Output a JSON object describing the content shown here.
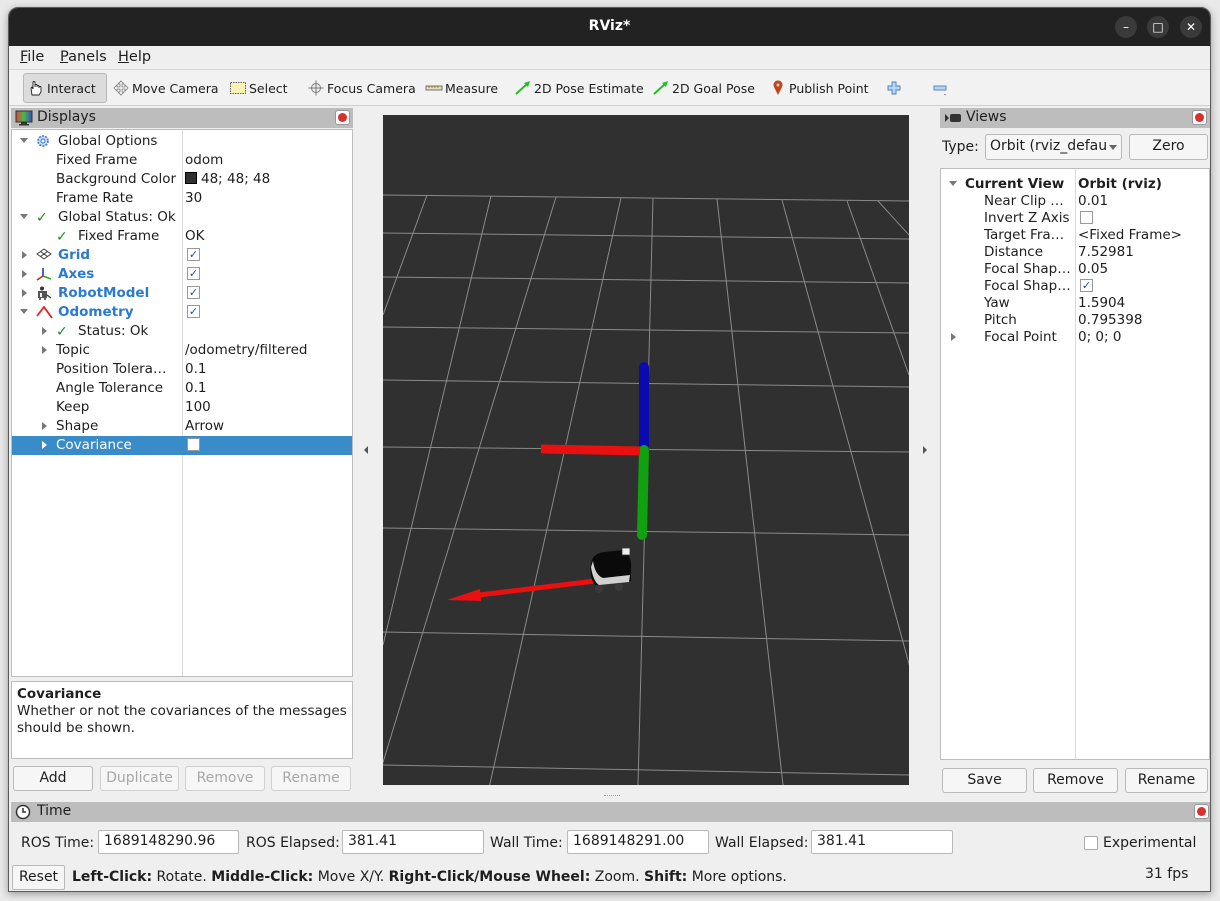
{
  "window": {
    "title": "RViz*",
    "controls": [
      "minimize",
      "maximize",
      "close"
    ]
  },
  "menu": {
    "items": [
      {
        "label": "File",
        "mnemonic": "F",
        "rest": "ile"
      },
      {
        "label": "Panels",
        "mnemonic": "P",
        "rest": "anels"
      },
      {
        "label": "Help",
        "mnemonic": "H",
        "rest": "elp"
      }
    ]
  },
  "toolbar": {
    "tools": [
      {
        "label": "Interact",
        "icon": "hand-pointer-icon",
        "active": true
      },
      {
        "label": "Move Camera",
        "icon": "move-camera-icon"
      },
      {
        "label": "Select",
        "icon": "select-box-icon"
      },
      {
        "label": "Focus Camera",
        "icon": "focus-crosshair-icon"
      },
      {
        "label": "Measure",
        "icon": "ruler-icon"
      },
      {
        "label": "2D Pose Estimate",
        "icon": "green-arrow-icon"
      },
      {
        "label": "2D Goal Pose",
        "icon": "green-arrow-icon"
      },
      {
        "label": "Publish Point",
        "icon": "map-pin-icon"
      }
    ],
    "add_tool_icon": "plus-icon",
    "remove_tool_icon": "minus-icon"
  },
  "displays": {
    "title": "Displays",
    "rows": [
      {
        "name": "Global Options",
        "value": "",
        "indent": 0,
        "expander": "down",
        "icon": "gear-icon"
      },
      {
        "name": "Fixed Frame",
        "value": "odom",
        "indent": 1
      },
      {
        "name": "Background Color",
        "value": "48; 48; 48",
        "indent": 1,
        "swatch": "#303030"
      },
      {
        "name": "Frame Rate",
        "value": "30",
        "indent": 1
      },
      {
        "name": "Global Status: Ok",
        "value": "",
        "indent": 0,
        "expander": "down",
        "icon": "check-icon"
      },
      {
        "name": "Fixed Frame",
        "value": "OK",
        "indent": 1,
        "icon": "check-icon"
      },
      {
        "name": "Grid",
        "value": "",
        "indent": 0,
        "expander": "right",
        "icon": "grid-icon",
        "display": true,
        "checked": true
      },
      {
        "name": "Axes",
        "value": "",
        "indent": 0,
        "expander": "right",
        "icon": "axes-icon",
        "display": true,
        "checked": true
      },
      {
        "name": "RobotModel",
        "value": "",
        "indent": 0,
        "expander": "right",
        "icon": "robot-icon",
        "display": true,
        "checked": true
      },
      {
        "name": "Odometry",
        "value": "",
        "indent": 0,
        "expander": "down",
        "icon": "odometry-icon",
        "display": true,
        "checked": true
      },
      {
        "name": "Status: Ok",
        "value": "",
        "indent": 1,
        "expander": "right",
        "icon": "check-icon"
      },
      {
        "name": "Topic",
        "value": "/odometry/filtered",
        "indent": 1,
        "expander": "right"
      },
      {
        "name": "Position Tolera…",
        "value": "0.1",
        "indent": 1
      },
      {
        "name": "Angle Tolerance",
        "value": "0.1",
        "indent": 1
      },
      {
        "name": "Keep",
        "value": "100",
        "indent": 1
      },
      {
        "name": "Shape",
        "value": "Arrow",
        "indent": 1,
        "expander": "right"
      },
      {
        "name": "Covariance",
        "value": "",
        "indent": 1,
        "expander": "right",
        "selected": true,
        "checkbox": true,
        "checked": false
      }
    ],
    "description_title": "Covariance",
    "description_text": "Whether or not the covariances of the messages should be shown.",
    "buttons": {
      "add": "Add",
      "duplicate": "Duplicate",
      "remove": "Remove",
      "rename": "Rename"
    }
  },
  "views": {
    "title": "Views",
    "type_label": "Type:",
    "type_value": "Orbit (rviz_defau",
    "zero_label": "Zero",
    "rows": [
      {
        "name": "Current View",
        "value": "Orbit (rviz)",
        "bold": true,
        "expander": "down"
      },
      {
        "name": "Near Clip …",
        "value": "0.01"
      },
      {
        "name": "Invert Z Axis",
        "value": "",
        "checkbox": true,
        "checked": false
      },
      {
        "name": "Target Fra…",
        "value": "<Fixed Frame>"
      },
      {
        "name": "Distance",
        "value": "7.52981"
      },
      {
        "name": "Focal Shap…",
        "value": "0.05"
      },
      {
        "name": "Focal Shap…",
        "value": "",
        "checkbox": true,
        "checked": true
      },
      {
        "name": "Yaw",
        "value": "1.5904"
      },
      {
        "name": "Pitch",
        "value": "0.795398"
      },
      {
        "name": "Focal Point",
        "value": "0; 0; 0",
        "expander": "right"
      }
    ],
    "buttons": {
      "save": "Save",
      "remove": "Remove",
      "rename": "Rename"
    }
  },
  "time": {
    "title": "Time",
    "ros_time_label": "ROS Time:",
    "ros_time": "1689148290.96",
    "ros_elapsed_label": "ROS Elapsed:",
    "ros_elapsed": "381.41",
    "wall_time_label": "Wall Time:",
    "wall_time": "1689148291.00",
    "wall_elapsed_label": "Wall Elapsed:",
    "wall_elapsed": "381.41",
    "experimental_label": "Experimental",
    "experimental_checked": false
  },
  "status": {
    "reset_label": "Reset",
    "hints": [
      {
        "key": "Left-Click:",
        "text": " Rotate. "
      },
      {
        "key": "Middle-Click:",
        "text": " Move X/Y. "
      },
      {
        "key": "Right-Click/Mouse Wheel:",
        "text": " Zoom. "
      },
      {
        "key": "Shift:",
        "text": " More options."
      }
    ],
    "fps": "31 fps"
  },
  "scene": {
    "background_color": "#303030",
    "grid_color": "#8a8a8a",
    "axes": {
      "x": "#e81010",
      "y": "#10a010",
      "z": "#0a0ab0"
    },
    "odometry_arrow_color": "#e81010"
  }
}
